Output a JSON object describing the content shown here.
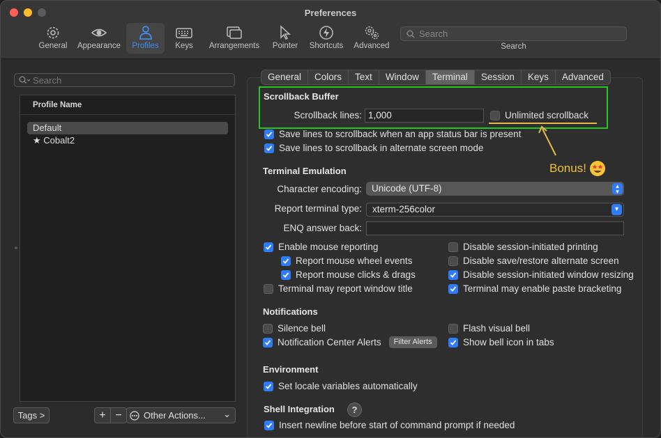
{
  "window": {
    "title": "Preferences",
    "traffic_lights": [
      "#ff5f57",
      "#febc2e",
      "#5b5b5b"
    ]
  },
  "toolbar": {
    "items": [
      {
        "label": "General",
        "icon": "gear-icon"
      },
      {
        "label": "Appearance",
        "icon": "eye-icon"
      },
      {
        "label": "Profiles",
        "icon": "person-icon",
        "active": true
      },
      {
        "label": "Keys",
        "icon": "keyboard-icon"
      },
      {
        "label": "Arrangements",
        "icon": "windows-icon"
      },
      {
        "label": "Pointer",
        "icon": "pointer-icon"
      },
      {
        "label": "Shortcuts",
        "icon": "bolt-icon"
      },
      {
        "label": "Advanced",
        "icon": "gears-icon"
      }
    ],
    "search_placeholder": "Search",
    "search_caption": "Search",
    "accent": "#3f8df0"
  },
  "profiles": {
    "search_placeholder": "Search",
    "column_header": "Profile Name",
    "items": [
      {
        "name": "Default",
        "selected": true
      },
      {
        "name": "Cobalt2",
        "starred": true,
        "star": "★"
      }
    ],
    "tags_button": "Tags >",
    "add_button": "+",
    "remove_button": "−",
    "other_actions": "Other Actions...",
    "other_actions_chevron": "⌄"
  },
  "tabs": [
    "General",
    "Colors",
    "Text",
    "Window",
    "Terminal",
    "Session",
    "Keys",
    "Advanced"
  ],
  "active_tab": "Terminal",
  "scrollback": {
    "heading": "Scrollback Buffer",
    "lines_label": "Scrollback lines:",
    "lines_value": "1,000",
    "unlimited_label": "Unlimited scrollback",
    "unlimited_checked": false,
    "save_status_bar": "Save lines to scrollback when an app status bar is present",
    "save_alternate": "Save lines to scrollback in alternate screen mode"
  },
  "annotation": {
    "text": "Bonus!",
    "emoji": "star-struck-emoji",
    "highlight_color": "#27c627",
    "note_color": "#f2c13a"
  },
  "emulation": {
    "heading": "Terminal Emulation",
    "encoding_label": "Character encoding:",
    "encoding_value": "Unicode (UTF-8)",
    "type_label": "Report terminal type:",
    "type_value": "xterm-256color",
    "enq_label": "ENQ answer back:",
    "enq_value": "",
    "options_left": [
      {
        "label": "Enable mouse reporting",
        "checked": true
      },
      {
        "label": "Report mouse wheel events",
        "checked": true
      },
      {
        "label": "Report mouse clicks & drags",
        "checked": true
      },
      {
        "label": "Terminal may report window title",
        "checked": false
      }
    ],
    "options_right": [
      {
        "label": "Disable session-initiated printing",
        "checked": false
      },
      {
        "label": "Disable save/restore alternate screen",
        "checked": false
      },
      {
        "label": "Disable session-initiated window resizing",
        "checked": true
      },
      {
        "label": "Terminal may enable paste bracketing",
        "checked": true
      }
    ]
  },
  "notifications": {
    "heading": "Notifications",
    "silence_bell": "Silence bell",
    "nc_alerts": "Notification Center Alerts",
    "filter_alerts": "Filter Alerts",
    "flash_visual": "Flash visual bell",
    "show_bell_icon": "Show bell icon in tabs"
  },
  "environment": {
    "heading": "Environment",
    "set_locale": "Set locale variables automatically"
  },
  "shell": {
    "heading": "Shell Integration",
    "help": "?",
    "insert_newline": "Insert newline before start of command prompt if needed"
  }
}
